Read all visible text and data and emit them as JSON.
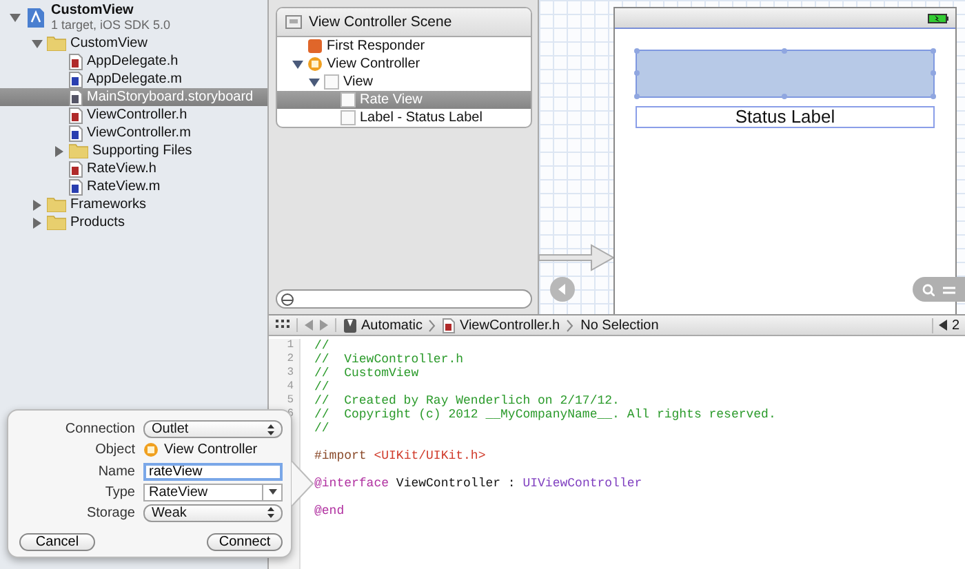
{
  "navigator": {
    "items": [
      {
        "kind": "project",
        "name": "CustomView",
        "subtitle": "1 target, iOS SDK 5.0",
        "expanded": true,
        "selected": false,
        "children": [
          {
            "kind": "folder",
            "name": "CustomView",
            "expanded": true,
            "selected": false,
            "children": [
              {
                "kind": "h",
                "name": "AppDelegate.h",
                "selected": false
              },
              {
                "kind": "m",
                "name": "AppDelegate.m",
                "selected": false
              },
              {
                "kind": "storyboard",
                "name": "MainStoryboard.storyboard",
                "selected": true
              },
              {
                "kind": "h",
                "name": "ViewController.h",
                "selected": false
              },
              {
                "kind": "m",
                "name": "ViewController.m",
                "selected": false
              },
              {
                "kind": "folder",
                "name": "Supporting Files",
                "expanded": false,
                "selected": false
              },
              {
                "kind": "h",
                "name": "RateView.h",
                "selected": false
              },
              {
                "kind": "m",
                "name": "RateView.m",
                "selected": false
              }
            ]
          },
          {
            "kind": "folder",
            "name": "Frameworks",
            "expanded": false,
            "selected": false
          },
          {
            "kind": "folder",
            "name": "Products",
            "expanded": false,
            "selected": false
          }
        ]
      }
    ]
  },
  "outline": {
    "title": "View Controller Scene",
    "items": [
      {
        "kind": "responder",
        "name": "First Responder",
        "selected": false
      },
      {
        "kind": "controller",
        "name": "View Controller",
        "expanded": true,
        "selected": false,
        "children": [
          {
            "kind": "view",
            "name": "View",
            "expanded": true,
            "selected": false,
            "children": [
              {
                "kind": "view",
                "name": "Rate View",
                "selected": true
              },
              {
                "kind": "view",
                "name": "Label - Status Label",
                "selected": false
              }
            ]
          }
        ]
      }
    ]
  },
  "canvas": {
    "status_label": "Status Label"
  },
  "jump_bar": {
    "items": [
      {
        "kind": "assistant",
        "label": "Automatic"
      },
      {
        "kind": "h",
        "label": "ViewController.h"
      },
      {
        "kind": "plain",
        "label": "No Selection"
      }
    ],
    "counterpart": "2"
  },
  "code": {
    "lines": [
      {
        "kind": "code",
        "number": "1",
        "tokens": [
          {
            "kind": "comment",
            "text": "//"
          }
        ]
      },
      {
        "kind": "code",
        "number": "2",
        "tokens": [
          {
            "kind": "comment",
            "text": "//  ViewController.h"
          }
        ]
      },
      {
        "kind": "code",
        "number": "3",
        "tokens": [
          {
            "kind": "comment",
            "text": "//  CustomView"
          }
        ]
      },
      {
        "kind": "code",
        "number": "4",
        "tokens": [
          {
            "kind": "comment",
            "text": "//"
          }
        ]
      },
      {
        "kind": "code",
        "number": "5",
        "tokens": [
          {
            "kind": "comment",
            "text": "//  Created by Ray Wenderlich on 2/17/12."
          }
        ]
      },
      {
        "kind": "code",
        "number": "6",
        "tokens": [
          {
            "kind": "comment",
            "text": "//  Copyright (c) 2012 __MyCompanyName__. All rights reserved."
          }
        ]
      },
      {
        "kind": "code",
        "tokens": [
          {
            "kind": "comment",
            "text": "//"
          }
        ]
      },
      {
        "kind": "blank"
      },
      {
        "kind": "code",
        "tokens": [
          {
            "kind": "preprocessor",
            "text": "#import "
          },
          {
            "kind": "string",
            "text": "<UIKit/UIKit.h>"
          }
        ]
      },
      {
        "kind": "blank"
      },
      {
        "kind": "code",
        "tokens": [
          {
            "kind": "keyword",
            "text": "@interface"
          },
          {
            "kind": "plain",
            "text": " ViewController : "
          },
          {
            "kind": "class",
            "text": "UIViewController"
          }
        ]
      },
      {
        "kind": "blank"
      },
      {
        "kind": "code",
        "tokens": [
          {
            "kind": "keyword",
            "text": "@end"
          }
        ]
      }
    ]
  },
  "popover": {
    "connection": {
      "label": "Connection",
      "value": "Outlet"
    },
    "object": {
      "label": "Object",
      "value": "View Controller"
    },
    "name": {
      "label": "Name",
      "value": "rateView"
    },
    "type": {
      "label": "Type",
      "value": "RateView"
    },
    "storage": {
      "label": "Storage",
      "value": "Weak"
    },
    "buttons": [
      "Cancel",
      "Connect"
    ]
  }
}
